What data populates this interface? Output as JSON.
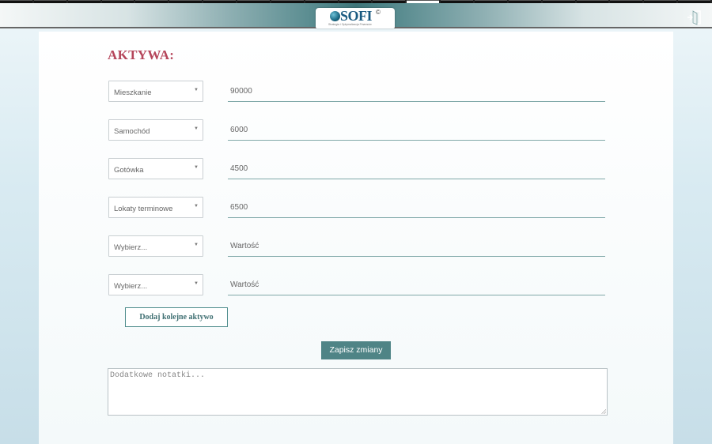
{
  "tabs": [
    {
      "active": false
    },
    {
      "active": false
    },
    {
      "active": false
    },
    {
      "active": false
    },
    {
      "active": false
    },
    {
      "active": false
    },
    {
      "active": false
    },
    {
      "active": false
    },
    {
      "active": false
    },
    {
      "active": false
    },
    {
      "active": false
    },
    {
      "active": false
    },
    {
      "active": true
    },
    {
      "active": false
    },
    {
      "active": false
    },
    {
      "active": false
    },
    {
      "active": false
    },
    {
      "active": false
    },
    {
      "active": false
    },
    {
      "active": false
    },
    {
      "active": false
    }
  ],
  "header": {
    "logo_text": "SOFI",
    "logo_copyright": "©",
    "logo_subtitle": "Strategia i Optymalizacja Finansów",
    "exit_icon": "exit-door-icon"
  },
  "main": {
    "title": "AKTYWA:",
    "assets": [
      {
        "category": "Mieszkanie",
        "value": "90000",
        "placeholder": "Wartość"
      },
      {
        "category": "Samochód",
        "value": "6000",
        "placeholder": "Wartość"
      },
      {
        "category": "Gotówka",
        "value": "4500",
        "placeholder": "Wartość"
      },
      {
        "category": "Lokaty terminowe",
        "value": "6500",
        "placeholder": "Wartość"
      },
      {
        "category": "Wybierz...",
        "value": "",
        "placeholder": "Wartość"
      },
      {
        "category": "Wybierz...",
        "value": "",
        "placeholder": "Wartość"
      }
    ],
    "add_label": "Dodaj kolejne aktywo",
    "save_label": "Zapisz zmiany",
    "notes_placeholder": "Dodatkowe notatki..."
  },
  "colors": {
    "title": "#b5455a",
    "accent": "#4f8486",
    "field_underline": "#7fa8a8"
  }
}
